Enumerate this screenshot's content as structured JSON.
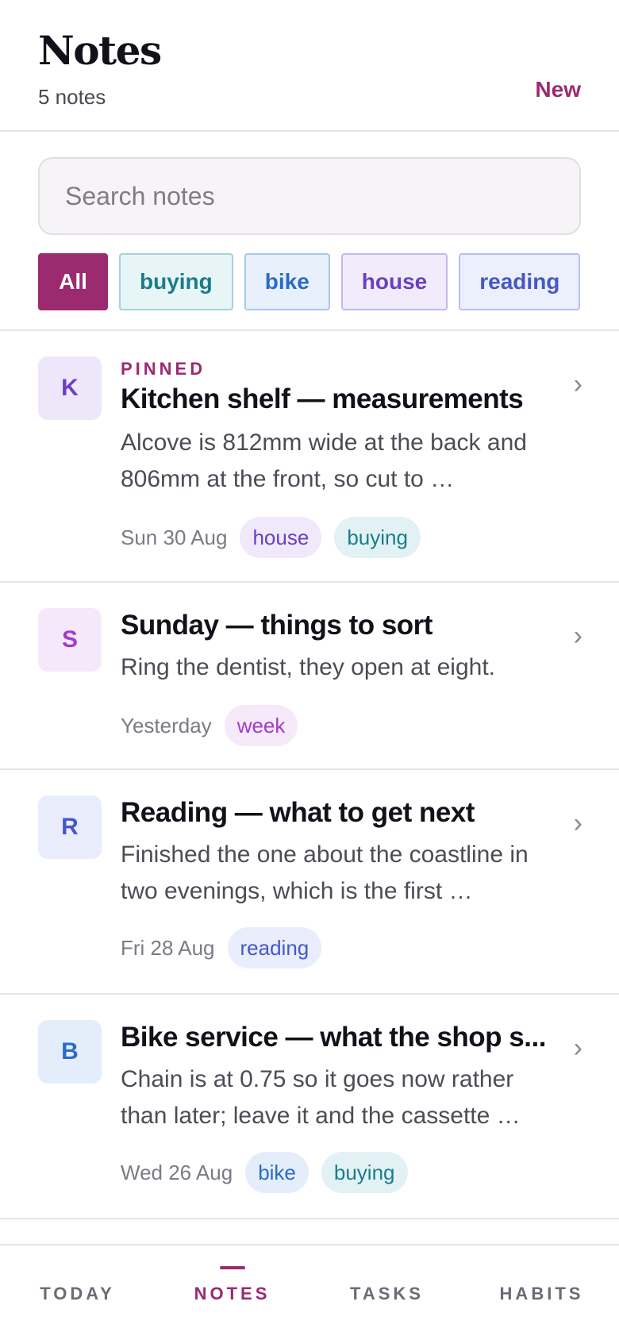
{
  "header": {
    "title": "Notes",
    "count": "5 notes",
    "new_label": "New"
  },
  "search": {
    "placeholder": "Search notes",
    "value": ""
  },
  "filters": [
    "All",
    "buying",
    "bike",
    "house",
    "reading"
  ],
  "notes": [
    {
      "initial": "K",
      "pinned_label": "PINNED",
      "title": "Kitchen shelf — measurements",
      "body": "Alcove is 812mm wide at the back and 806mm at the front, so cut to …",
      "date": "Sun 30 Aug",
      "tags": [
        "house",
        "buying"
      ]
    },
    {
      "initial": "S",
      "title": "Sunday — things to sort",
      "body": "Ring the dentist, they open at eight.",
      "date": "Yesterday",
      "tags": [
        "week"
      ]
    },
    {
      "initial": "R",
      "title": "Reading — what to get next",
      "body": "Finished the one about the coastline in two evenings, which is the first …",
      "date": "Fri 28 Aug",
      "tags": [
        "reading"
      ]
    },
    {
      "initial": "B",
      "title": "Bike service — what the shop s...",
      "body": "Chain is at 0.75 so it goes now rather than later; leave it and the cassette …",
      "date": "Wed 26 Aug",
      "tags": [
        "bike",
        "buying"
      ]
    }
  ],
  "tabs": [
    "TODAY",
    "NOTES",
    "TASKS",
    "HABITS"
  ],
  "active_tab": "NOTES",
  "colors": {
    "accent": "#9b2a6e",
    "divider": "#e6e4e8"
  },
  "icons": {
    "row_chevron": "chevron-right-icon"
  }
}
